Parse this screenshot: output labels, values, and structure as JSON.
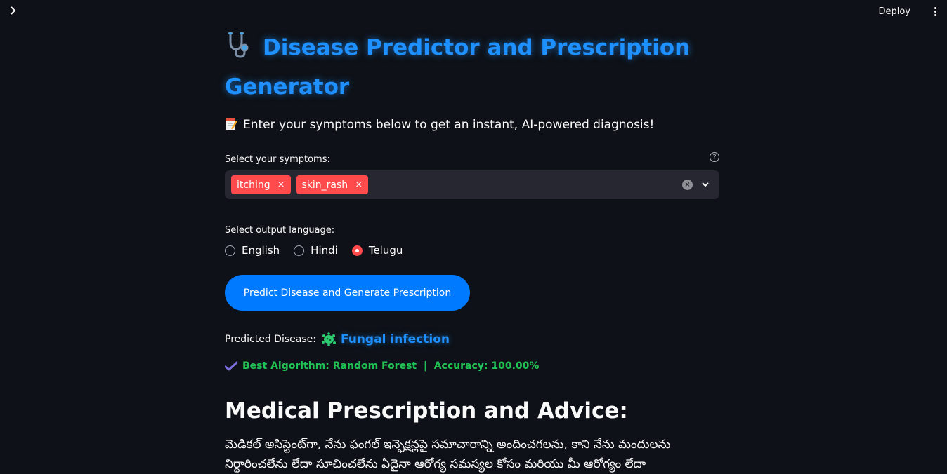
{
  "app": {
    "deploy_label": "Deploy"
  },
  "header": {
    "title": "Disease Predictor and Prescription Generator",
    "subtitle": "Enter your symptoms below to get an instant, AI-powered diagnosis!"
  },
  "symptoms": {
    "label": "Select your symptoms:",
    "help_glyph": "?",
    "selected": [
      "itching",
      "skin_rash"
    ],
    "remove_glyph": "×",
    "clear_glyph": "×"
  },
  "language": {
    "label": "Select output language:",
    "options": [
      "English",
      "Hindi",
      "Telugu"
    ],
    "selected": "Telugu"
  },
  "actions": {
    "predict_label": "Predict Disease and Generate Prescription"
  },
  "result": {
    "predicted_label": "Predicted Disease:",
    "predicted_value": "Fungal infection",
    "algorithm_text": "Best Algorithm: Random Forest  |  Accuracy: 100.00%"
  },
  "prescription": {
    "heading": "Medical Prescription and Advice:",
    "body": "మెడికల్ అసిస్టెంట్‌గా, నేను ఫంగల్ ఇన్ఫెక్షన్లపై సమాచారాన్ని అందించగలను, కాని నేను మందులను నిర్ధారించలేను లేదా సూచించలేను ఏదైనా ఆరోగ్య సమస్యల కోసం మరియు మీ ఆరోగ్యం లేదా"
  },
  "colors": {
    "background": "#0e1117",
    "accent_blue": "#1e90ff",
    "button_blue": "#007bff",
    "chip_red": "#ff4b4b",
    "success_green": "#21c354"
  },
  "icons": {
    "sidebar": "chevron-right-icon",
    "menu": "kebab-menu-icon",
    "title": "stethoscope-icon",
    "subtitle": "memo-icon",
    "disease": "germ-icon",
    "algorithm": "check-mark-icon"
  }
}
